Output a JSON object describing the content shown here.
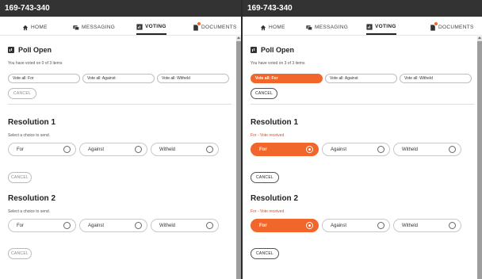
{
  "colors": {
    "accent": "#f0662b",
    "titlebar": "#333333"
  },
  "panels": [
    {
      "title": "169-743-340",
      "tabs": [
        {
          "label": "HOME",
          "icon": "home-icon"
        },
        {
          "label": "MESSAGING",
          "icon": "messaging-icon"
        },
        {
          "label": "VOTING",
          "icon": "voting-icon",
          "active": true
        },
        {
          "label": "DOCUMENTS",
          "icon": "document-icon",
          "badge": true
        }
      ],
      "poll": {
        "title": "Poll Open",
        "voted_text": "You have voted on 0 of 3 items",
        "vote_all": [
          "Vote all: For",
          "Vote all: Against",
          "Vote all: Witheld"
        ],
        "vote_all_selected": "",
        "cancel": "CANCEL"
      },
      "resolutions": [
        {
          "title": "Resolution 1",
          "status": "Select a choice to send.",
          "received": false,
          "choices": [
            "For",
            "Against",
            "Witheld"
          ],
          "selected": "",
          "cancel": "CANCEL"
        },
        {
          "title": "Resolution 2",
          "status": "Select a choice to send.",
          "received": false,
          "choices": [
            "For",
            "Against",
            "Witheld"
          ],
          "selected": "",
          "cancel": "CANCEL"
        }
      ]
    },
    {
      "title": "169-743-340",
      "tabs": [
        {
          "label": "HOME",
          "icon": "home-icon"
        },
        {
          "label": "MESSAGING",
          "icon": "messaging-icon"
        },
        {
          "label": "VOTING",
          "icon": "voting-icon",
          "active": true
        },
        {
          "label": "DOCUMENTS",
          "icon": "document-icon",
          "badge": true
        }
      ],
      "poll": {
        "title": "Poll Open",
        "voted_text": "You have voted on 3 of 3 items",
        "vote_all": [
          "Vote all: For",
          "Vote all: Against",
          "Vote all: Witheld"
        ],
        "vote_all_selected": "Vote all: For",
        "cancel": "CANCEL"
      },
      "resolutions": [
        {
          "title": "Resolution 1",
          "status": "For - Vote received",
          "received": true,
          "choices": [
            "For",
            "Against",
            "Witheld"
          ],
          "selected": "For",
          "cancel": "CANCEL"
        },
        {
          "title": "Resolution 2",
          "status": "For - Vote received",
          "received": true,
          "choices": [
            "For",
            "Against",
            "Witheld"
          ],
          "selected": "For",
          "cancel": "CANCEL"
        }
      ]
    }
  ]
}
